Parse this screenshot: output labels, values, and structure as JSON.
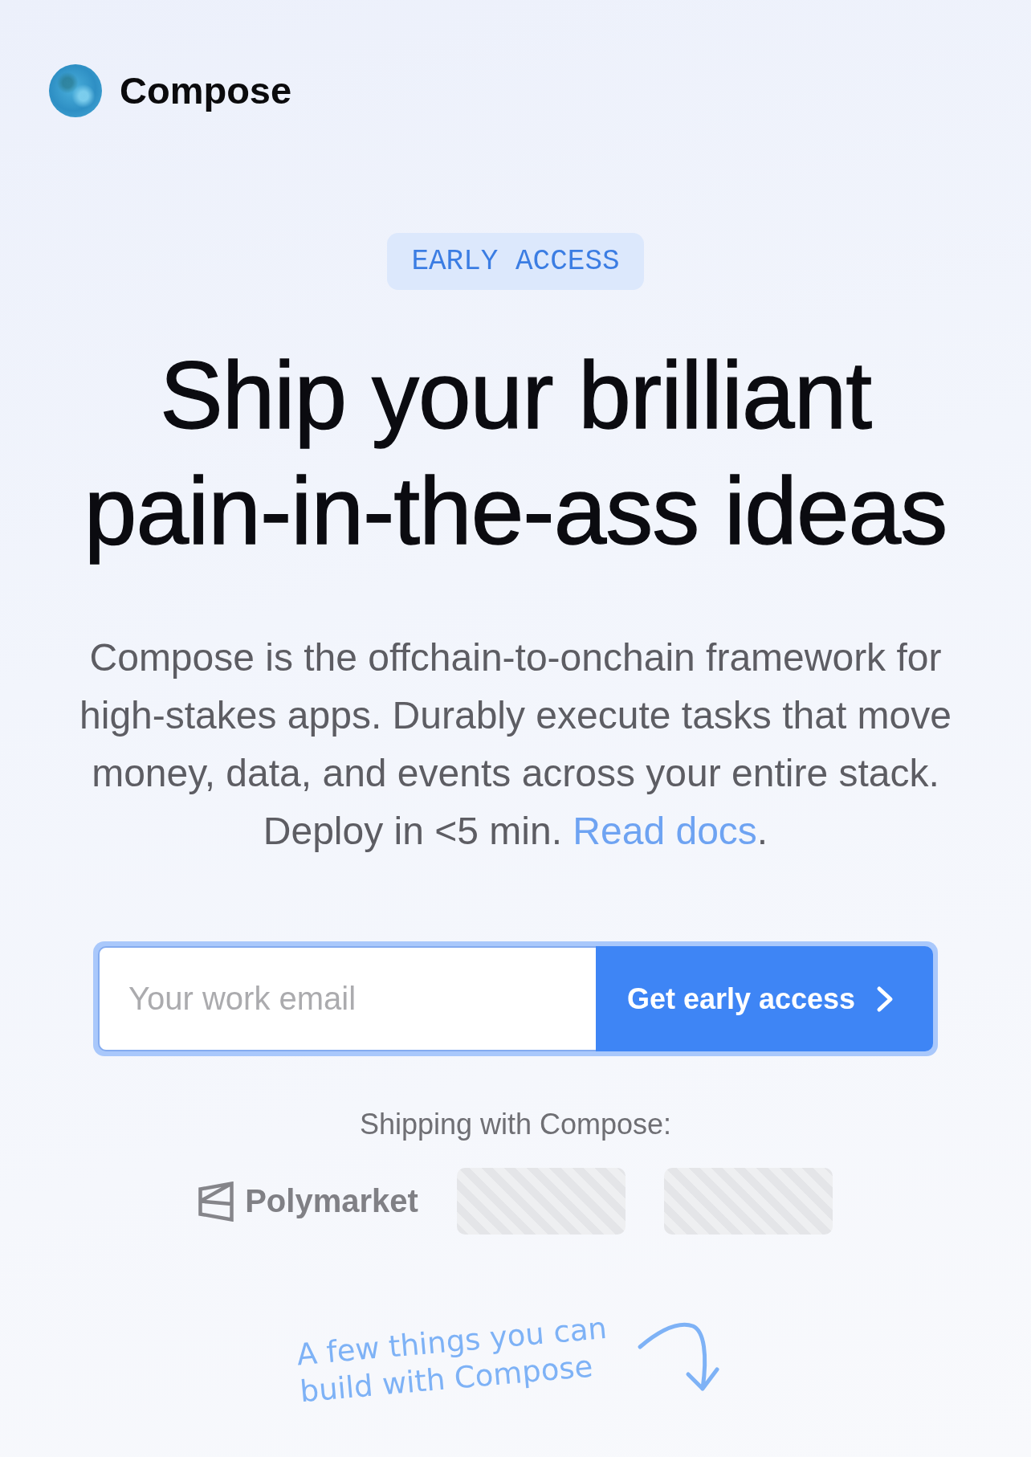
{
  "header": {
    "brand": "Compose"
  },
  "badge": "EARLY ACCESS",
  "heading": "Ship your brilliant pain-in-the-ass ideas",
  "description": {
    "text": "Compose is the offchain-to-onchain framework for high-stakes apps. Durably execute tasks that move money, data, and events across your entire stack. Deploy in <5 min.",
    "link": "Read docs",
    "end": "."
  },
  "signup": {
    "placeholder": "Your work email",
    "button": "Get early access"
  },
  "shipping": {
    "label": "Shipping with Compose:",
    "logos": [
      {
        "kind": "brand",
        "name": "Polymarket"
      },
      {
        "kind": "placeholder"
      },
      {
        "kind": "placeholder"
      }
    ]
  },
  "note": "A few things you can build with Compose"
}
